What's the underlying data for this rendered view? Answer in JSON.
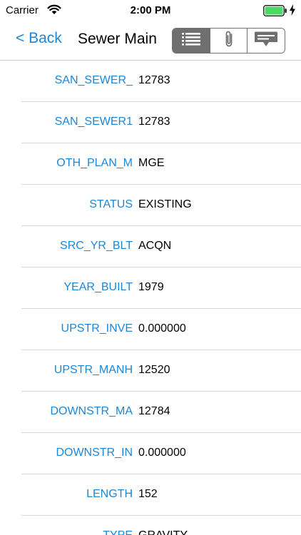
{
  "status_bar": {
    "carrier": "Carrier",
    "time": "2:00 PM",
    "wifi_icon": "wifi-icon",
    "battery_icon": "battery-icon",
    "battery_color": "#4cd964"
  },
  "nav": {
    "back_label": "< Back",
    "title": "Sewer Main",
    "segments": [
      {
        "icon": "list-icon",
        "active": true
      },
      {
        "icon": "paperclip-icon",
        "active": false
      },
      {
        "icon": "card-icon",
        "active": false
      }
    ]
  },
  "colors": {
    "accent": "#1a87d9",
    "segment": "#6f6f6f"
  },
  "attributes": [
    {
      "label": "SAN_SEWER_",
      "value": "12783"
    },
    {
      "label": "SAN_SEWER1",
      "value": "12783"
    },
    {
      "label": "OTH_PLAN_M",
      "value": "MGE"
    },
    {
      "label": "STATUS",
      "value": "EXISTING"
    },
    {
      "label": "SRC_YR_BLT",
      "value": "ACQN"
    },
    {
      "label": "YEAR_BUILT",
      "value": "1979"
    },
    {
      "label": "UPSTR_INVE",
      "value": "0.000000"
    },
    {
      "label": "UPSTR_MANH",
      "value": "12520"
    },
    {
      "label": "DOWNSTR_MA",
      "value": "12784"
    },
    {
      "label": "DOWNSTR_IN",
      "value": "0.000000"
    },
    {
      "label": "LENGTH",
      "value": "152"
    },
    {
      "label": "TYPE",
      "value": "GRAVITY"
    }
  ]
}
